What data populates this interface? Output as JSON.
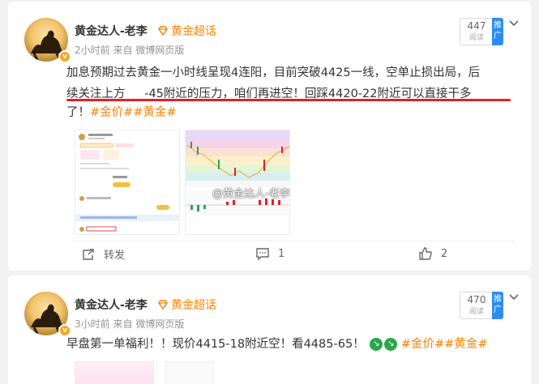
{
  "posts": [
    {
      "author": "黄金达人-老李",
      "badge": "黄金超话",
      "time": "2小时前",
      "source_prefix": "来自",
      "source": "微博网页版",
      "read_count": "447",
      "read_label": "阅读",
      "promo": "推广",
      "text_line1": "加息预期过去黄金一小时线呈现4连阳，目前突破4425一线，空单止损出局，后",
      "text_line2": "续关注上方 　 -45附近的压力，咱们再进空！回踩4420-22附近可以直接干多",
      "text_line3_prefix": "了！",
      "tags": [
        "#金价#",
        "#黄金#"
      ],
      "watermark": "@黄金达人-老李",
      "actions": {
        "forward": "转发",
        "comment": "1",
        "like": "2"
      }
    },
    {
      "author": "黄金达人-老李",
      "badge": "黄金超话",
      "time": "3小时前",
      "source_prefix": "来自",
      "source": "微博网页版",
      "read_count": "470",
      "read_label": "阅读",
      "promo": "推广",
      "text_line1": "早盘第一单福利！！现价4415-18附近空！看4485-65！",
      "tags": [
        "#金价#",
        "#黄金#"
      ]
    }
  ],
  "colors": {
    "accent": "#ff8200",
    "highlight_line": "#e0202a",
    "promo": "#2e8cf0",
    "muted": "#939393"
  }
}
